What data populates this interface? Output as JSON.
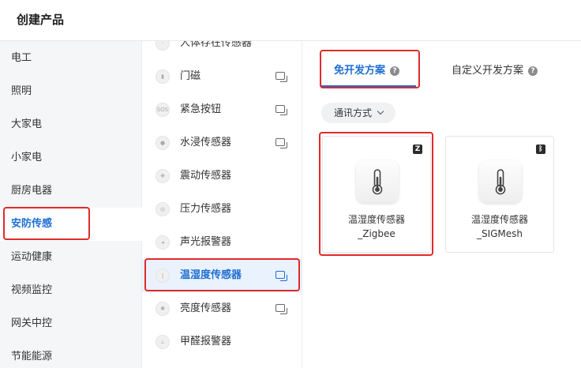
{
  "header": {
    "title": "创建产品"
  },
  "categories": [
    {
      "label": "电工"
    },
    {
      "label": "照明"
    },
    {
      "label": "大家电"
    },
    {
      "label": "小家电"
    },
    {
      "label": "厨房电器"
    },
    {
      "label": "安防传感"
    },
    {
      "label": "运动健康"
    },
    {
      "label": "视频监控"
    },
    {
      "label": "网关中控"
    },
    {
      "label": "节能能源"
    }
  ],
  "selected_category": "安防传感",
  "subcategories": [
    {
      "label": "人体存在传感器",
      "has_chat": false
    },
    {
      "label": "门磁",
      "has_chat": true
    },
    {
      "label": "紧急按钮",
      "has_chat": true
    },
    {
      "label": "水浸传感器",
      "has_chat": true
    },
    {
      "label": "震动传感器",
      "has_chat": false
    },
    {
      "label": "压力传感器",
      "has_chat": false
    },
    {
      "label": "声光报警器",
      "has_chat": false
    },
    {
      "label": "温湿度传感器",
      "has_chat": true
    },
    {
      "label": "亮度传感器",
      "has_chat": true
    },
    {
      "label": "甲醛报警器",
      "has_chat": false
    }
  ],
  "selected_subcategory": "温湿度传感器",
  "tabs": [
    {
      "label": "免开发方案"
    },
    {
      "label": "自定义开发方案"
    }
  ],
  "filter": {
    "label": "通讯方式"
  },
  "products": [
    {
      "name_line1": "温湿度传感器",
      "name_line2": "_Zigbee",
      "badge": "Z",
      "badge_icon": "zigbee-icon"
    },
    {
      "name_line1": "温湿度传感器",
      "name_line2": "_SIGMesh",
      "badge": "ᛒ",
      "badge_icon": "bluetooth-icon"
    }
  ],
  "colors": {
    "accent": "#1f6fd1",
    "highlight": "#e02b2b",
    "sidebar_bg": "#f5f6f8"
  }
}
